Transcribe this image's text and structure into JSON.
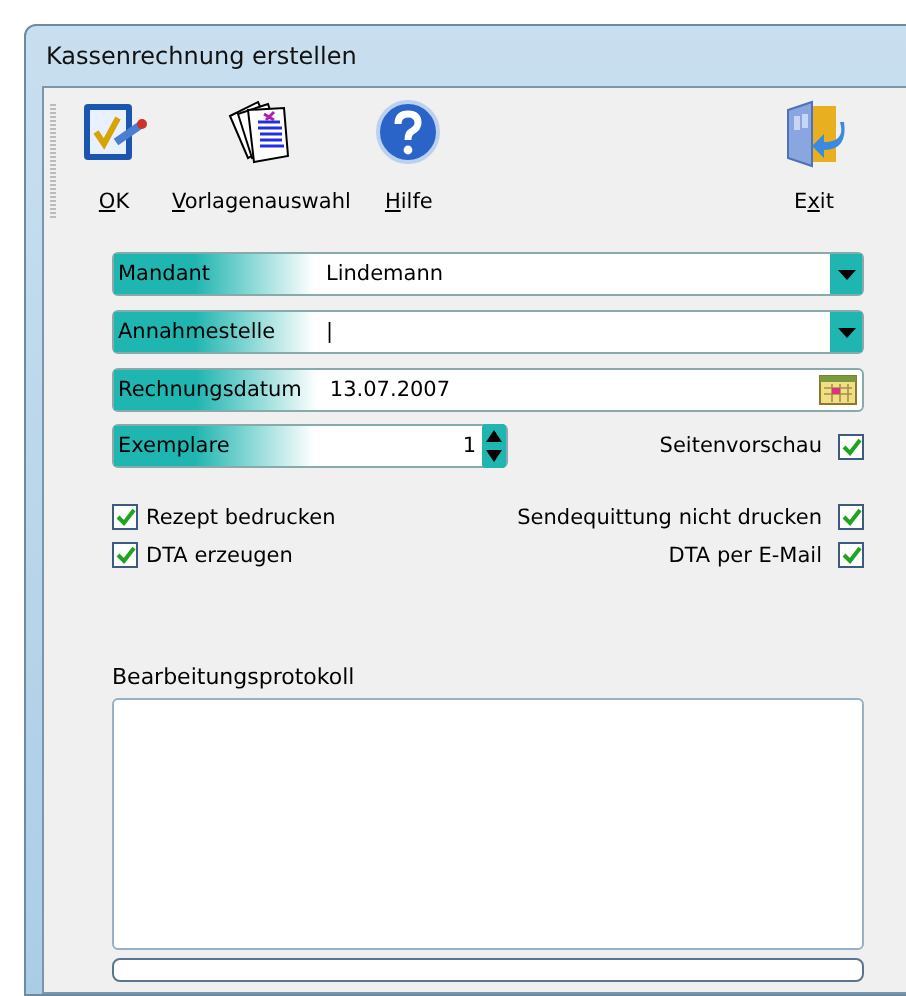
{
  "window": {
    "title": "Kassenrechnung  erstellen"
  },
  "toolbar": [
    {
      "kind": "ok",
      "key": "O",
      "post": "K"
    },
    {
      "kind": "templates",
      "key": "V",
      "post": "orlagenauswahl"
    },
    {
      "kind": "help",
      "key": "H",
      "post": "ilfe"
    },
    {
      "kind": "exit",
      "pre": "E",
      "key": "x",
      "post": "it"
    }
  ],
  "fields": [
    {
      "kind": "dropdown",
      "label": "Mandant",
      "value": "Lindemann"
    },
    {
      "kind": "dropdown",
      "label": "Annahmestelle",
      "value": "|"
    },
    {
      "kind": "date",
      "label": "Rechnungsdatum",
      "value": "13.07.2007"
    }
  ],
  "copies": {
    "label": "Exemplare",
    "value": "1"
  },
  "preview": {
    "label": "Seitenvorschau",
    "checked": true
  },
  "options_left": [
    {
      "label": "Rezept bedrucken",
      "checked": true
    },
    {
      "label": "DTA erzeugen",
      "checked": true
    }
  ],
  "options_right": [
    {
      "label": "Sendequittung nicht drucken",
      "checked": true
    },
    {
      "label": "DTA per E-Mail",
      "checked": true
    }
  ],
  "log": {
    "label": "Bearbeitungsprotokoll"
  }
}
